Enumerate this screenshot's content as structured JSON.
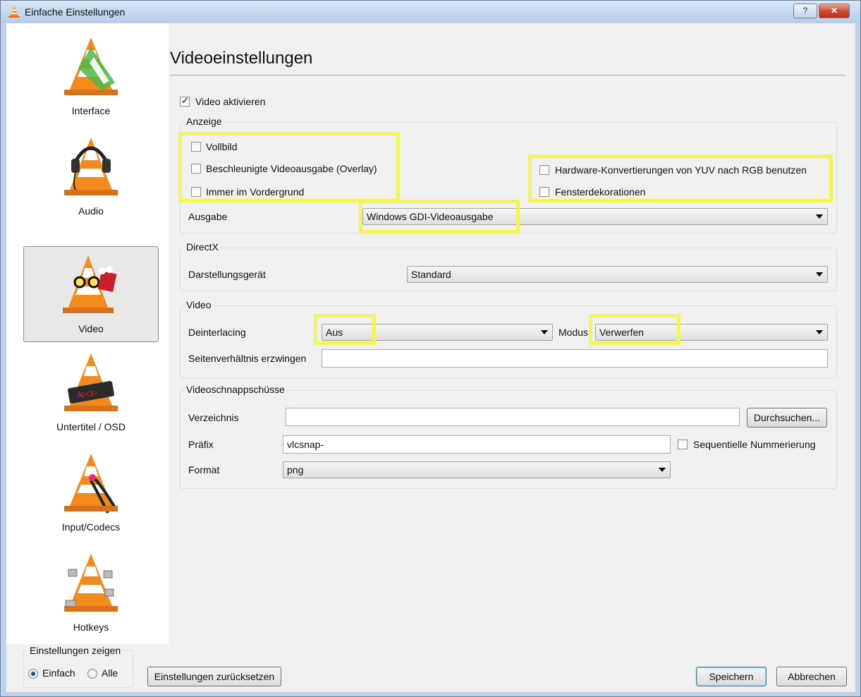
{
  "window": {
    "title": "Einfache Einstellungen",
    "help_label": "?",
    "close_label": "✕"
  },
  "sidebar": {
    "items": [
      {
        "label": "Interface"
      },
      {
        "label": "Audio"
      },
      {
        "label": "Video",
        "selected": true
      },
      {
        "label": "Untertitel / OSD"
      },
      {
        "label": "Input/Codecs"
      },
      {
        "label": "Hotkeys"
      }
    ],
    "show_settings": {
      "title": "Einstellungen zeigen",
      "options": [
        "Einfach",
        "Alle"
      ],
      "selected": "Einfach"
    }
  },
  "main": {
    "heading": "Videoeinstellungen",
    "enable_video": {
      "label": "Video aktivieren",
      "checked": true
    },
    "anzeige": {
      "title": "Anzeige",
      "fullscreen": "Vollbild",
      "overlay": "Beschleunigte Videoausgabe (Overlay)",
      "on_top": "Immer im Vordergrund",
      "yuv_rgb": "Hardware-Konvertierungen von YUV nach RGB benutzen",
      "decorations": "Fensterdekorationen",
      "output_label": "Ausgabe",
      "output_value": "Windows GDI-Videoausgabe"
    },
    "directx": {
      "title": "DirectX",
      "device_label": "Darstellungsgerät",
      "device_value": "Standard"
    },
    "video": {
      "title": "Video",
      "deinterlacing_label": "Deinterlacing",
      "deinterlacing_value": "Aus",
      "mode_label": "Modus",
      "mode_value": "Verwerfen",
      "aspect_label": "Seitenverhältnis erzwingen",
      "aspect_value": ""
    },
    "snapshots": {
      "title": "Videoschnappschüsse",
      "dir_label": "Verzeichnis",
      "dir_value": "",
      "browse_label": "Durchsuchen...",
      "prefix_label": "Präfix",
      "prefix_value": "vlcsnap-",
      "sequential_label": "Sequentielle Nummerierung",
      "format_label": "Format",
      "format_value": "png"
    }
  },
  "buttons": {
    "reset": "Einstellungen zurücksetzen",
    "save": "Speichern",
    "cancel": "Abbrechen"
  },
  "colors": {
    "highlight": "#f3f35a",
    "vlc_orange": "#f28a1e"
  }
}
